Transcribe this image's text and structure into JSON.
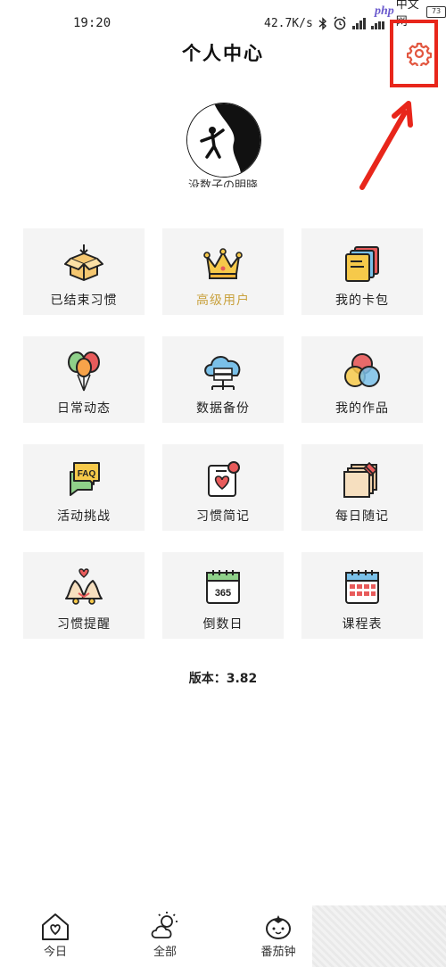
{
  "status_bar": {
    "time": "19:20",
    "net_speed": "42.7K/s",
    "battery": "73"
  },
  "watermark": {
    "logo": "php",
    "text": "中文网"
  },
  "header": {
    "title": "个人中心"
  },
  "profile": {
    "username": "没数子の明晓"
  },
  "grid": [
    {
      "label": "已结束习惯",
      "icon": "open-box-icon"
    },
    {
      "label": "高级用户",
      "icon": "crown-icon",
      "accent": "#c9a23f"
    },
    {
      "label": "我的卡包",
      "icon": "card-stack-icon"
    },
    {
      "label": "日常动态",
      "icon": "balloons-icon"
    },
    {
      "label": "数据备份",
      "icon": "cloud-server-icon"
    },
    {
      "label": "我的作品",
      "icon": "venn-circles-icon"
    },
    {
      "label": "活动挑战",
      "icon": "faq-bubble-icon"
    },
    {
      "label": "习惯简记",
      "icon": "heart-note-icon"
    },
    {
      "label": "每日随记",
      "icon": "pinned-notes-icon"
    },
    {
      "label": "习惯提醒",
      "icon": "wedding-bells-icon"
    },
    {
      "label": "倒数日",
      "icon": "calendar-365-icon"
    },
    {
      "label": "课程表",
      "icon": "timetable-icon"
    }
  ],
  "version": "版本：3.82",
  "bottom_nav": [
    {
      "label": "今日",
      "icon": "house-heart-icon"
    },
    {
      "label": "全部",
      "icon": "sun-cloud-icon"
    },
    {
      "label": "番茄钟",
      "icon": "tomato-icon"
    }
  ],
  "colors": {
    "highlight": "#e8261b",
    "gold": "#c9a23f",
    "tile_bg": "#f4f4f4"
  }
}
